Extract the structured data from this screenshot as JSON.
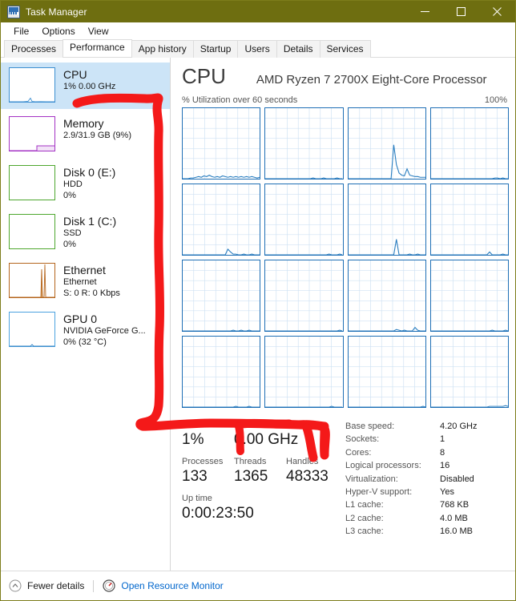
{
  "window": {
    "title": "Task Manager",
    "icon": "task-manager-icon",
    "titlebar_color": "#6e6e10",
    "controls": [
      {
        "name": "minimize",
        "glyph": "minimize-icon"
      },
      {
        "name": "maximize",
        "glyph": "maximize-icon"
      },
      {
        "name": "close",
        "glyph": "close-icon"
      }
    ]
  },
  "menu": {
    "items": [
      "File",
      "Options",
      "View"
    ]
  },
  "tabs": {
    "active": "Performance",
    "items": [
      "Processes",
      "Performance",
      "App history",
      "Startup",
      "Users",
      "Details",
      "Services"
    ]
  },
  "sidebar": {
    "selected_index": 0,
    "items": [
      {
        "name": "cpu",
        "title": "CPU",
        "sub1": "1%  0.00 GHz",
        "sub2": "",
        "color": "#3d8fd1",
        "selected": true
      },
      {
        "name": "memory",
        "title": "Memory",
        "sub1": "2.9/31.9 GB (9%)",
        "sub2": "",
        "color": "#a433c4",
        "selected": false
      },
      {
        "name": "disk-0",
        "title": "Disk 0 (E:)",
        "sub1": "HDD",
        "sub2": "0%",
        "color": "#4ea72e",
        "selected": false
      },
      {
        "name": "disk-1",
        "title": "Disk 1 (C:)",
        "sub1": "SSD",
        "sub2": "0%",
        "color": "#4ea72e",
        "selected": false
      },
      {
        "name": "ethernet",
        "title": "Ethernet",
        "sub1": "Ethernet",
        "sub2": "S: 0 R: 0 Kbps",
        "color": "#b5651d",
        "selected": false
      },
      {
        "name": "gpu-0",
        "title": "GPU 0",
        "sub1": "NVIDIA GeForce G...",
        "sub2": "0% (32 °C)",
        "color": "#4da3e0",
        "selected": false
      }
    ]
  },
  "main": {
    "title": "CPU",
    "subtitle": "AMD Ryzen 7 2700X Eight-Core Processor",
    "graph_caption_left": "% Utilization over 60 seconds",
    "graph_caption_right": "100%",
    "graph_count": 16,
    "graph_border_color": "#1f6fb5",
    "graph_grid_color": "#cfe2f3"
  },
  "chart_data": {
    "type": "line",
    "title": "% Utilization over 60 seconds",
    "ylabel": "% Utilization",
    "xlabel": "60 seconds",
    "ylim": [
      0,
      100
    ],
    "grid": true,
    "panels": 16,
    "note": "16 logical processor utilization graphs, 4x4 grid",
    "series": [
      {
        "name": "CPU 0",
        "values": [
          0,
          0,
          0,
          1,
          1,
          2,
          3,
          2,
          4,
          3,
          5,
          3,
          2,
          3,
          2,
          4,
          3,
          2,
          3,
          2,
          3,
          2,
          3,
          2,
          3,
          2,
          3,
          2,
          1,
          2
        ]
      },
      {
        "name": "CPU 1",
        "values": [
          0,
          0,
          0,
          0,
          0,
          0,
          0,
          0,
          0,
          0,
          0,
          0,
          0,
          0,
          0,
          0,
          0,
          0,
          1,
          0,
          0,
          0,
          1,
          0,
          0,
          0,
          0,
          1,
          0,
          0
        ]
      },
      {
        "name": "CPU 2",
        "values": [
          0,
          0,
          0,
          0,
          0,
          0,
          0,
          0,
          0,
          0,
          0,
          0,
          0,
          0,
          0,
          0,
          0,
          48,
          20,
          8,
          5,
          4,
          14,
          5,
          4,
          3,
          3,
          2,
          2,
          2
        ]
      },
      {
        "name": "CPU 3",
        "values": [
          0,
          0,
          0,
          0,
          0,
          0,
          0,
          0,
          0,
          0,
          0,
          0,
          0,
          0,
          0,
          0,
          0,
          0,
          0,
          0,
          0,
          0,
          0,
          0,
          1,
          1,
          0,
          1,
          0,
          0
        ]
      },
      {
        "name": "CPU 4",
        "values": [
          0,
          0,
          0,
          0,
          0,
          0,
          0,
          0,
          0,
          0,
          0,
          0,
          0,
          0,
          0,
          0,
          0,
          8,
          4,
          1,
          1,
          0,
          0,
          1,
          0,
          0,
          1,
          0,
          0,
          0
        ]
      },
      {
        "name": "CPU 5",
        "values": [
          0,
          0,
          0,
          0,
          0,
          0,
          0,
          0,
          0,
          0,
          0,
          0,
          0,
          0,
          0,
          0,
          0,
          0,
          0,
          0,
          0,
          0,
          0,
          0,
          1,
          0,
          0,
          0,
          1,
          0
        ]
      },
      {
        "name": "CPU 6",
        "values": [
          0,
          0,
          0,
          0,
          0,
          0,
          0,
          0,
          0,
          0,
          0,
          0,
          0,
          0,
          0,
          0,
          0,
          0,
          22,
          0,
          0,
          0,
          0,
          1,
          0,
          0,
          1,
          0,
          0,
          0
        ]
      },
      {
        "name": "CPU 7",
        "values": [
          0,
          0,
          0,
          0,
          0,
          0,
          0,
          0,
          0,
          0,
          0,
          0,
          0,
          0,
          0,
          0,
          0,
          0,
          0,
          0,
          0,
          0,
          4,
          0,
          0,
          0,
          0,
          1,
          0,
          0
        ]
      },
      {
        "name": "CPU 8",
        "values": [
          0,
          0,
          0,
          0,
          0,
          0,
          0,
          0,
          0,
          0,
          0,
          0,
          0,
          0,
          0,
          0,
          0,
          0,
          0,
          1,
          0,
          0,
          1,
          0,
          0,
          1,
          0,
          0,
          0,
          0
        ]
      },
      {
        "name": "CPU 9",
        "values": [
          0,
          0,
          0,
          0,
          0,
          0,
          0,
          0,
          0,
          0,
          0,
          0,
          0,
          0,
          0,
          0,
          0,
          0,
          0,
          0,
          0,
          0,
          0,
          0,
          0,
          0,
          0,
          0,
          1,
          0
        ]
      },
      {
        "name": "CPU 10",
        "values": [
          0,
          0,
          0,
          0,
          0,
          0,
          0,
          0,
          0,
          0,
          0,
          0,
          0,
          0,
          0,
          0,
          0,
          0,
          2,
          1,
          0,
          1,
          0,
          0,
          0,
          5,
          1,
          0,
          0,
          0
        ]
      },
      {
        "name": "CPU 11",
        "values": [
          0,
          0,
          0,
          0,
          0,
          0,
          0,
          0,
          0,
          0,
          0,
          0,
          0,
          0,
          0,
          0,
          0,
          0,
          0,
          0,
          0,
          0,
          0,
          1,
          0,
          0,
          0,
          0,
          1,
          0
        ]
      },
      {
        "name": "CPU 12",
        "values": [
          0,
          0,
          0,
          0,
          0,
          0,
          0,
          0,
          0,
          0,
          0,
          0,
          0,
          0,
          0,
          0,
          0,
          0,
          0,
          0,
          1,
          0,
          0,
          0,
          0,
          1,
          0,
          0,
          0,
          0
        ]
      },
      {
        "name": "CPU 13",
        "values": [
          0,
          0,
          0,
          0,
          0,
          0,
          0,
          0,
          0,
          0,
          0,
          0,
          0,
          0,
          0,
          0,
          0,
          0,
          0,
          0,
          0,
          0,
          0,
          0,
          0,
          1,
          0,
          0,
          0,
          0
        ]
      },
      {
        "name": "CPU 14",
        "values": [
          0,
          0,
          0,
          0,
          0,
          0,
          0,
          0,
          0,
          0,
          0,
          0,
          0,
          0,
          0,
          0,
          0,
          0,
          0,
          0,
          0,
          0,
          0,
          0,
          0,
          0,
          0,
          0,
          1,
          0
        ]
      },
      {
        "name": "CPU 15",
        "values": [
          0,
          0,
          0,
          0,
          0,
          0,
          0,
          0,
          0,
          0,
          0,
          0,
          0,
          0,
          0,
          0,
          0,
          0,
          0,
          0,
          0,
          0,
          1,
          1,
          1,
          1,
          1,
          1,
          2,
          1
        ]
      }
    ]
  },
  "stats": {
    "utilization": {
      "label": "Utilization",
      "value": "1%"
    },
    "speed": {
      "label": "Speed",
      "value": "0.00 GHz"
    },
    "processes": {
      "label": "Processes",
      "value": "133"
    },
    "threads": {
      "label": "Threads",
      "value": "1365"
    },
    "handles": {
      "label": "Handles",
      "value": "48333"
    },
    "uptime": {
      "label": "Up time",
      "value": "0:00:23:50"
    }
  },
  "specs": [
    {
      "label": "Base speed:",
      "value": "4.20 GHz"
    },
    {
      "label": "Sockets:",
      "value": "1"
    },
    {
      "label": "Cores:",
      "value": "8"
    },
    {
      "label": "Logical processors:",
      "value": "16"
    },
    {
      "label": "Virtualization:",
      "value": "Disabled"
    },
    {
      "label": "Hyper-V support:",
      "value": "Yes"
    },
    {
      "label": "L1 cache:",
      "value": "768 KB"
    },
    {
      "label": "L2 cache:",
      "value": "4.0 MB"
    },
    {
      "label": "L3 cache:",
      "value": "16.0 MB"
    }
  ],
  "footer": {
    "fewer_details": "Fewer details",
    "fewer_details_icon": "chevron-up-circle-icon",
    "resource_monitor": "Open Resource Monitor",
    "resource_monitor_icon": "resource-monitor-gauge-icon",
    "link_color": "#0066cc"
  },
  "annotation": {
    "color": "#f41919",
    "description": "hand-drawn red line linking CPU speed in sidebar to Speed value in stats"
  }
}
